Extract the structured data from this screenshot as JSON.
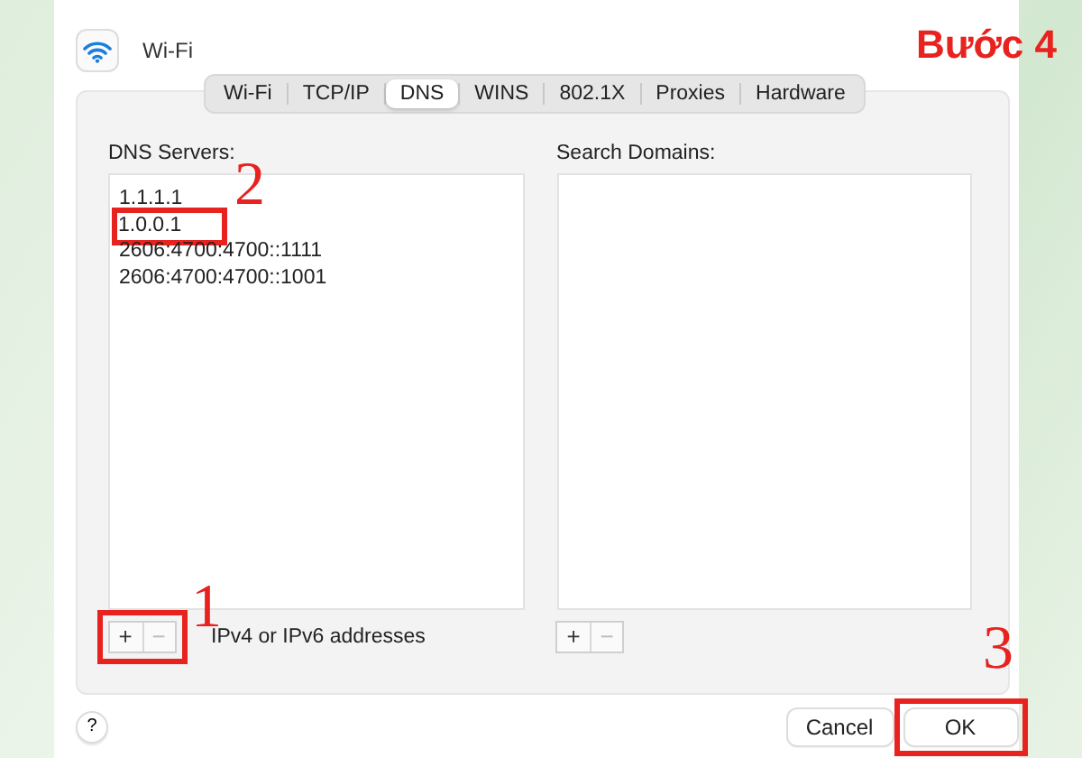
{
  "window": {
    "title": "Wi-Fi"
  },
  "tabs": [
    {
      "label": "Wi-Fi",
      "selected": false
    },
    {
      "label": "TCP/IP",
      "selected": false
    },
    {
      "label": "DNS",
      "selected": true
    },
    {
      "label": "WINS",
      "selected": false
    },
    {
      "label": "802.1X",
      "selected": false
    },
    {
      "label": "Proxies",
      "selected": false
    },
    {
      "label": "Hardware",
      "selected": false
    }
  ],
  "dns_servers": {
    "label": "DNS Servers:",
    "entries": [
      {
        "text": "1.1.1.1",
        "highlighted": false
      },
      {
        "text": "1.0.0.1",
        "highlighted": true
      },
      {
        "text": "2606:4700:4700::1111",
        "highlighted": false
      },
      {
        "text": "2606:4700:4700::1001",
        "highlighted": false
      }
    ],
    "add": "+",
    "remove": "−",
    "controls_highlighted": true,
    "hint": "IPv4 or IPv6 addresses"
  },
  "search_domains": {
    "label": "Search Domains:",
    "add": "+",
    "remove": "−",
    "controls_highlighted": false
  },
  "footer": {
    "help": "?",
    "buttons": [
      {
        "label": "Cancel",
        "highlighted": false
      },
      {
        "label": "OK",
        "highlighted": true
      }
    ]
  },
  "annotations": {
    "title": "Bước 4",
    "steps": [
      "2",
      "1",
      "3"
    ]
  }
}
